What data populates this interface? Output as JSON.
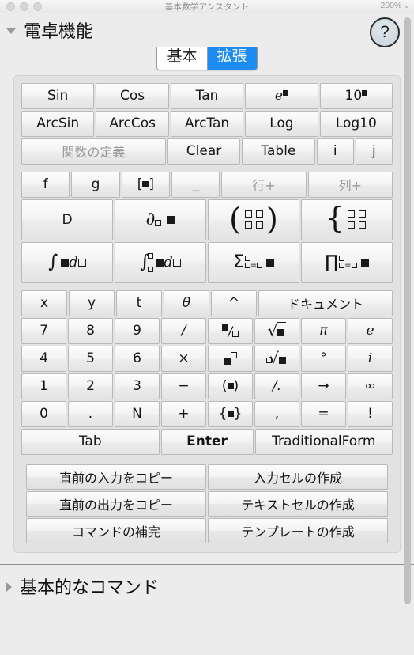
{
  "window": {
    "title": "基本数学アシスタント",
    "zoom": "200%",
    "traffic_lights": [
      "close",
      "minimize",
      "maximize"
    ]
  },
  "section": {
    "title": "電卓機能",
    "help_label": "?",
    "expanded": true
  },
  "tabs": [
    {
      "label": "基本",
      "active": false
    },
    {
      "label": "拡張",
      "active": true
    }
  ],
  "accent_color": "#1d8cf5",
  "keypad": {
    "groups": [
      {
        "name": "functions",
        "rows": [
          [
            {
              "label": "Sin",
              "kind": "text"
            },
            {
              "label": "Cos",
              "kind": "text"
            },
            {
              "label": "Tan",
              "kind": "text"
            },
            {
              "label": "e■",
              "kind": "sup-e"
            },
            {
              "label": "10■",
              "kind": "sup-10"
            }
          ],
          [
            {
              "label": "ArcSin",
              "kind": "text"
            },
            {
              "label": "ArcCos",
              "kind": "text"
            },
            {
              "label": "ArcTan",
              "kind": "text"
            },
            {
              "label": "Log",
              "kind": "text"
            },
            {
              "label": "Log10",
              "kind": "text"
            }
          ],
          [
            {
              "label": "関数の定義",
              "kind": "text",
              "disabled": true,
              "span": 2
            },
            {
              "label": "Clear",
              "kind": "text"
            },
            {
              "label": "Table",
              "kind": "text"
            },
            {
              "label": "i",
              "kind": "text",
              "half": true
            },
            {
              "label": "j",
              "kind": "text",
              "half": true
            }
          ]
        ]
      },
      {
        "name": "symbolic",
        "rows": [
          [
            {
              "label": "f",
              "kind": "text"
            },
            {
              "label": "g",
              "kind": "text"
            },
            {
              "label": "[■]",
              "kind": "bracket-ph"
            },
            {
              "label": "_",
              "kind": "underscore"
            },
            {
              "label": "行+",
              "kind": "text",
              "disabled": true
            },
            {
              "label": "列+",
              "kind": "text",
              "disabled": true
            }
          ],
          [
            {
              "label": "D",
              "kind": "text"
            },
            {
              "label": "∂□ ■",
              "kind": "partial"
            },
            {
              "label": "( □□ / □□ )",
              "kind": "matrix-paren"
            },
            {
              "label": "{ □□ / □□",
              "kind": "matrix-brace"
            }
          ],
          [
            {
              "label": "∫■d□",
              "kind": "integral"
            },
            {
              "label": "∫□□■d□",
              "kind": "integral-def"
            },
            {
              "label": "Σ□=□□ ■",
              "kind": "sum"
            },
            {
              "label": "∏□=□□ ■",
              "kind": "product"
            }
          ]
        ]
      },
      {
        "name": "numeric",
        "rows": [
          [
            {
              "label": "x",
              "kind": "text"
            },
            {
              "label": "y",
              "kind": "text"
            },
            {
              "label": "t",
              "kind": "text"
            },
            {
              "label": "θ",
              "kind": "text"
            },
            {
              "label": "^",
              "kind": "text"
            },
            {
              "label": "ドキュメント",
              "kind": "text",
              "span": 3
            }
          ],
          [
            {
              "label": "7",
              "kind": "text"
            },
            {
              "label": "8",
              "kind": "text"
            },
            {
              "label": "9",
              "kind": "text"
            },
            {
              "label": "/",
              "kind": "text"
            },
            {
              "label": "■/□",
              "kind": "fraction"
            },
            {
              "label": "√■",
              "kind": "sqrt"
            },
            {
              "label": "π",
              "kind": "text"
            },
            {
              "label": "e",
              "kind": "text"
            }
          ],
          [
            {
              "label": "4",
              "kind": "text"
            },
            {
              "label": "5",
              "kind": "text"
            },
            {
              "label": "6",
              "kind": "text"
            },
            {
              "label": "×",
              "kind": "text"
            },
            {
              "label": "■□",
              "kind": "power"
            },
            {
              "label": "□√■",
              "kind": "nthroot"
            },
            {
              "label": "°",
              "kind": "text"
            },
            {
              "label": "i",
              "kind": "text"
            }
          ],
          [
            {
              "label": "1",
              "kind": "text"
            },
            {
              "label": "2",
              "kind": "text"
            },
            {
              "label": "3",
              "kind": "text"
            },
            {
              "label": "−",
              "kind": "text"
            },
            {
              "label": "(■)",
              "kind": "paren-ph"
            },
            {
              "label": "/.",
              "kind": "text"
            },
            {
              "label": "→",
              "kind": "text"
            },
            {
              "label": "∞",
              "kind": "text"
            }
          ],
          [
            {
              "label": "0",
              "kind": "text"
            },
            {
              "label": ".",
              "kind": "text"
            },
            {
              "label": "N",
              "kind": "text"
            },
            {
              "label": "+",
              "kind": "text"
            },
            {
              "label": "{■}",
              "kind": "brace-ph"
            },
            {
              "label": ",",
              "kind": "text"
            },
            {
              "label": "=",
              "kind": "text"
            },
            {
              "label": "!",
              "kind": "text"
            }
          ],
          [
            {
              "label": "Tab",
              "kind": "text",
              "span": 3
            },
            {
              "label": "Enter",
              "kind": "text",
              "span": 2,
              "bold": true
            },
            {
              "label": "TraditionalForm",
              "kind": "text",
              "span": 3
            }
          ]
        ]
      }
    ]
  },
  "commands": {
    "rows": [
      [
        "直前の入力をコピー",
        "入力セルの作成"
      ],
      [
        "直前の出力をコピー",
        "テキストセルの作成"
      ],
      [
        "コマンドの補完",
        "テンプレートの作成"
      ]
    ]
  },
  "bottom_section": {
    "title": "基本的なコマンド",
    "expanded": false
  }
}
